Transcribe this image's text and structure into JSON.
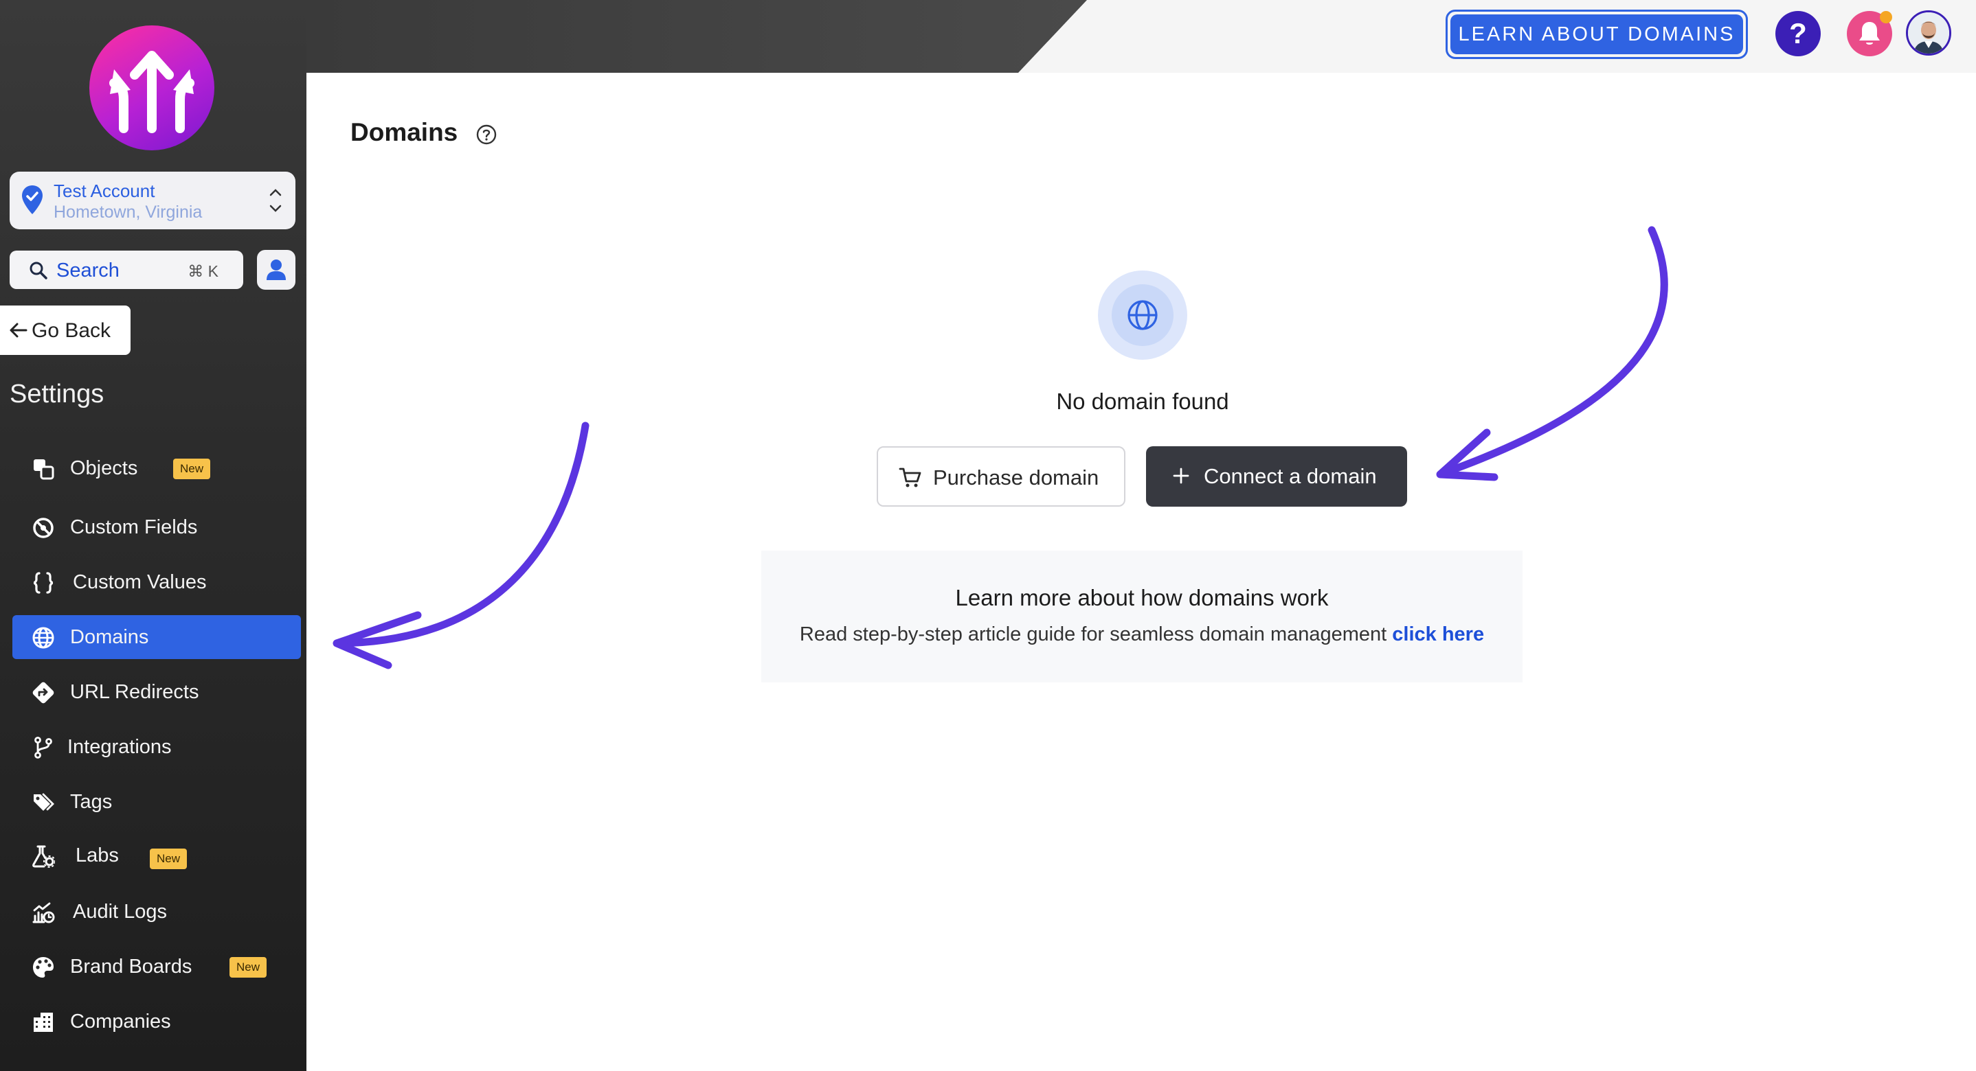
{
  "account": {
    "name": "Test Account",
    "location": "Hometown, Virginia"
  },
  "search": {
    "label": "Search",
    "shortcut": "⌘ K"
  },
  "go_back": "Go Back",
  "settings_title": "Settings",
  "nav": [
    {
      "label": "Objects",
      "icon": "objects-icon",
      "badge": "New"
    },
    {
      "label": "Custom Fields",
      "icon": "custom-fields-icon"
    },
    {
      "label": "Custom Values",
      "icon": "braces-icon"
    },
    {
      "label": "Domains",
      "icon": "globe-icon",
      "active": true
    },
    {
      "label": "URL Redirects",
      "icon": "redirect-icon"
    },
    {
      "label": "Integrations",
      "icon": "integrations-icon"
    },
    {
      "label": "Tags",
      "icon": "tags-icon"
    },
    {
      "label": "Labs",
      "icon": "labs-icon",
      "badge": "New"
    },
    {
      "label": "Audit Logs",
      "icon": "audit-logs-icon"
    },
    {
      "label": "Brand Boards",
      "icon": "palette-icon",
      "badge": "New"
    },
    {
      "label": "Companies",
      "icon": "companies-icon"
    }
  ],
  "topbar": {
    "learn_button": "LEARN ABOUT DOMAINS",
    "help": "?"
  },
  "main": {
    "title": "Domains",
    "empty_title": "No domain found",
    "purchase_button": "Purchase domain",
    "connect_button": "Connect a domain",
    "learn_title": "Learn more about how domains work",
    "learn_text": "Read step-by-step article guide for seamless domain management",
    "learn_link": "click here"
  },
  "colors": {
    "accent": "#2f63e2",
    "annotation_arrow": "#5b35e0",
    "badge": "#f7c24a",
    "sidebar": "#2b2b2b"
  }
}
